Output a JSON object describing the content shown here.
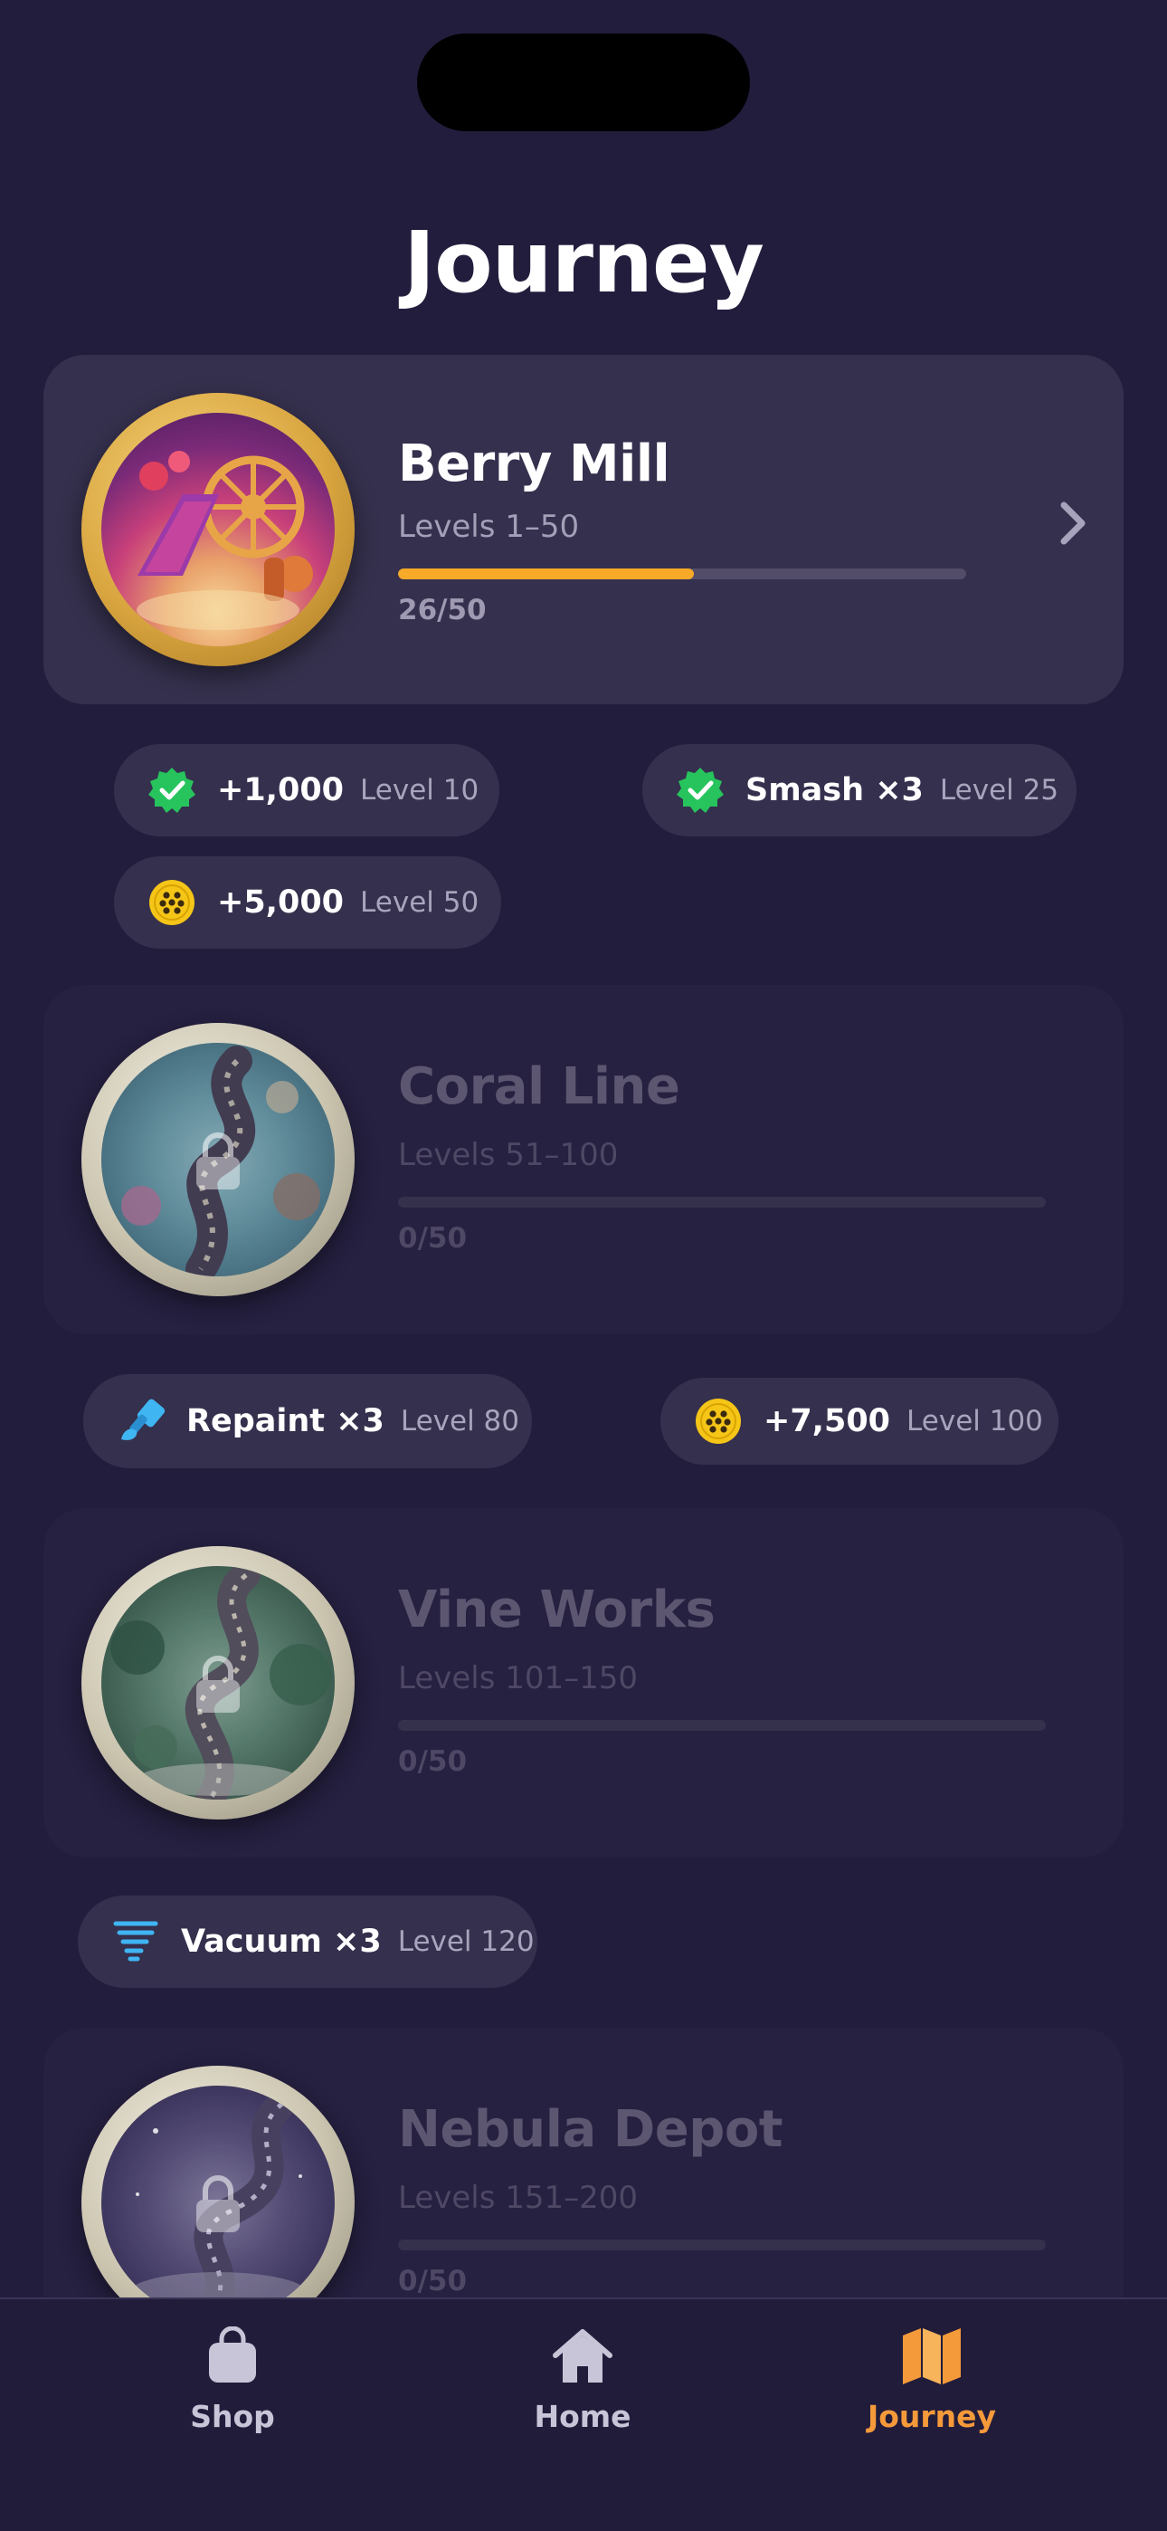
{
  "page": {
    "title": "Journey"
  },
  "cards": [
    {
      "name": "Berry Mill",
      "levels": "Levels 1–50",
      "progress_text": "26/50",
      "progress": 0.52,
      "state": "active",
      "medal": "gold",
      "icon": "chevron-right-icon"
    },
    {
      "name": "Coral Line",
      "levels": "Levels 51–100",
      "progress_text": "0/50",
      "progress": 0,
      "state": "locked",
      "medal": "silver",
      "icon": "lock-icon"
    },
    {
      "name": "Vine Works",
      "levels": "Levels 101–150",
      "progress_text": "0/50",
      "progress": 0,
      "state": "locked",
      "medal": "silver",
      "icon": "lock-icon"
    },
    {
      "name": "Nebula Depot",
      "levels": "Levels 151–200",
      "progress_text": "0/50",
      "progress": 0,
      "state": "locked",
      "medal": "silver",
      "icon": "lock-icon"
    }
  ],
  "rewards": [
    {
      "value": "+1,000",
      "level": "Level 10",
      "icon": "check-badge-icon",
      "claimed": true
    },
    {
      "value": "Smash ×3",
      "level": "Level 25",
      "icon": "check-badge-icon",
      "claimed": true
    },
    {
      "value": "+5,000",
      "level": "Level 50",
      "icon": "coin-icon"
    },
    {
      "value": "Repaint ×3",
      "level": "Level 80",
      "icon": "paint-brush-icon"
    },
    {
      "value": "+7,500",
      "level": "Level 100",
      "icon": "coin-icon"
    },
    {
      "value": "Vacuum ×3",
      "level": "Level 120",
      "icon": "tornado-icon"
    }
  ],
  "tabbar": {
    "tabs": [
      {
        "label": "Shop",
        "icon": "shopping-bag-icon",
        "active": false
      },
      {
        "label": "Home",
        "icon": "home-icon",
        "active": false
      },
      {
        "label": "Journey",
        "icon": "map-icon",
        "active": true
      }
    ]
  },
  "colors": {
    "background": "#231d3d",
    "card_active": "#35304d",
    "card_locked": "#262041",
    "accent_progress": "#f7a928",
    "tab_active": "#f49a3a",
    "check_green": "#27c45d",
    "coin_yellow": "#f5c518",
    "tool_blue": "#3fb5f2"
  }
}
